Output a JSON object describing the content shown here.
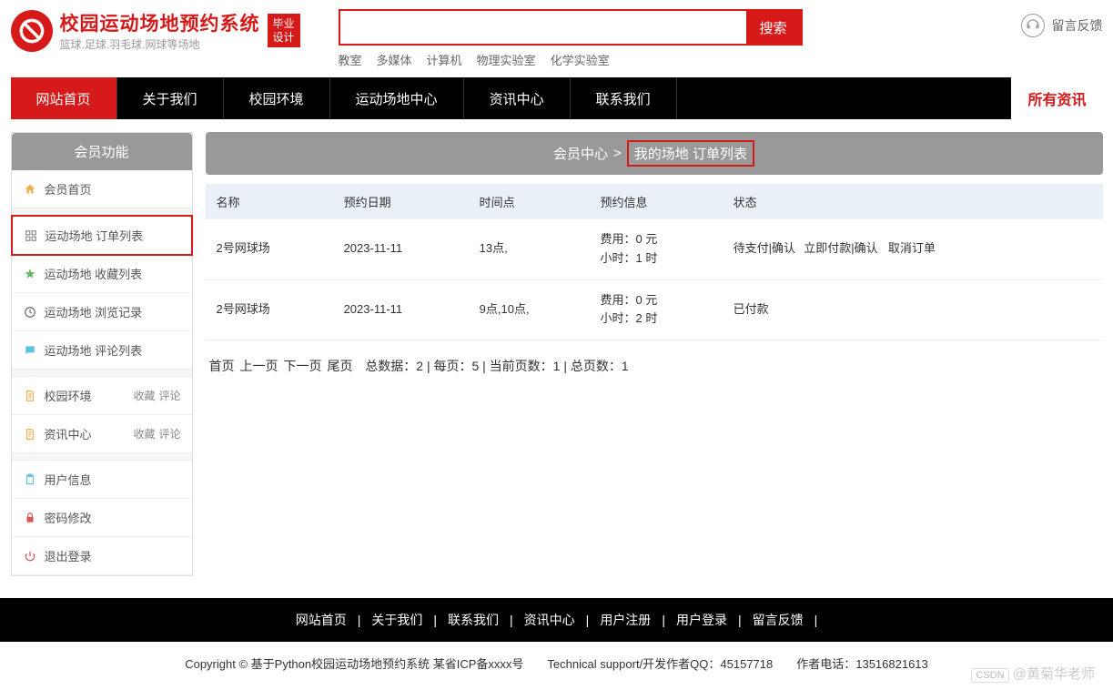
{
  "brand": {
    "title": "校园运动场地预约系统",
    "subtitle": "篮球.足球.羽毛球.网球等场地",
    "badge_line1": "毕业",
    "badge_line2": "设计"
  },
  "search": {
    "placeholder": "",
    "button": "搜索",
    "links": [
      "教室",
      "多媒体",
      "计算机",
      "物理实验室",
      "化学实验室"
    ]
  },
  "feedback_label": "留言反馈",
  "nav": {
    "items": [
      "网站首页",
      "关于我们",
      "校园环境",
      "运动场地中心",
      "资讯中心",
      "联系我们"
    ],
    "active_index": 0,
    "right_label": "所有资讯"
  },
  "sidebar": {
    "header": "会员功能",
    "groups": [
      [
        {
          "icon": "home-icon",
          "label": "会员首页",
          "color": "#f0ad4e"
        }
      ],
      [
        {
          "icon": "grid-icon",
          "label": "运动场地 订单列表",
          "color": "#888",
          "highlight": true
        },
        {
          "icon": "star-icon",
          "label": "运动场地 收藏列表",
          "color": "#5cb85c"
        },
        {
          "icon": "history-icon",
          "label": "运动场地 浏览记录",
          "color": "#666"
        },
        {
          "icon": "comment-icon",
          "label": "运动场地 评论列表",
          "color": "#5bc0de"
        }
      ],
      [
        {
          "icon": "doc-icon",
          "label": "校园环境",
          "sub": [
            "收藏",
            "评论"
          ],
          "color": "#f0ad4e"
        },
        {
          "icon": "doc-icon",
          "label": "资讯中心",
          "sub": [
            "收藏",
            "评论"
          ],
          "color": "#f0ad4e"
        }
      ],
      [
        {
          "icon": "clipboard-icon",
          "label": "用户信息",
          "color": "#5bc0de"
        },
        {
          "icon": "lock-icon",
          "label": "密码修改",
          "color": "#d9534f"
        },
        {
          "icon": "power-icon",
          "label": "退出登录",
          "color": "#d9534f"
        }
      ]
    ]
  },
  "breadcrumb": {
    "parent": "会员中心",
    "separator": ">",
    "current": "我的场地 订单列表"
  },
  "table": {
    "headers": [
      "名称",
      "预约日期",
      "时间点",
      "预约信息",
      "状态"
    ],
    "rows": [
      {
        "name": "2号网球场",
        "date": "2023-11-11",
        "time": "13点,",
        "info_line1": "费用：0 元",
        "info_line2": "小时：1 时",
        "status_text": "待支付|确认",
        "actions": [
          "立即付款|确认",
          "取消订单"
        ]
      },
      {
        "name": "2号网球场",
        "date": "2023-11-11",
        "time": "9点,10点,",
        "info_line1": "费用：0 元",
        "info_line2": "小时：2 时",
        "status_text": "已付款",
        "actions": []
      }
    ]
  },
  "pagination": {
    "links": [
      "首页",
      "上一页",
      "下一页",
      "尾页"
    ],
    "info": "总数据：2 | 每页：5 | 当前页数：1 | 总页数：1"
  },
  "footer": {
    "links": [
      "网站首页",
      "关于我们",
      "联系我们",
      "资讯中心",
      "用户注册",
      "用户登录",
      "留言反馈"
    ],
    "copyright": "Copyright © 基于Python校园运动场地预约系统 某省ICP备xxxx号　　Technical support/开发作者QQ：45157718　　作者电话：13516821613"
  },
  "watermark": {
    "logo": "CSDN",
    "text": "@黄菊华老师"
  }
}
